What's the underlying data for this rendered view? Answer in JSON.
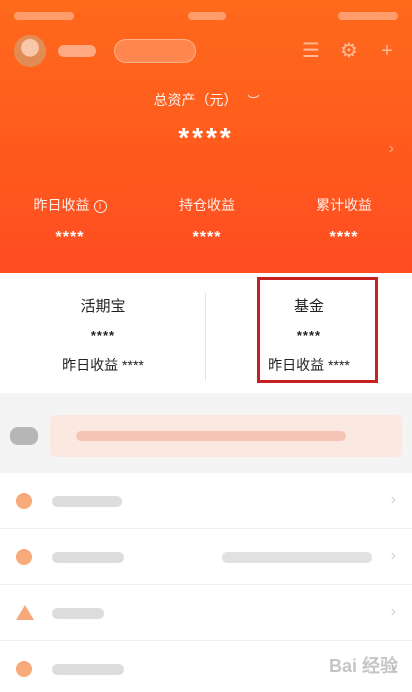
{
  "header": {
    "total_label": "总资产（元）",
    "total_value": "****",
    "eye_icon": "hidden-eye-icon",
    "earnings": [
      {
        "label": "昨日收益",
        "value": "****",
        "has_info": true
      },
      {
        "label": "持仓收益",
        "value": "****",
        "has_info": false
      },
      {
        "label": "累计收益",
        "value": "****",
        "has_info": false
      }
    ]
  },
  "cards": [
    {
      "title": "活期宝",
      "amount": "****",
      "sub_label": "昨日收益 ****"
    },
    {
      "title": "基金",
      "amount": "****",
      "sub_label": "昨日收益 ****"
    }
  ],
  "watermark": "Bai 经验",
  "colors": {
    "accent": "#ff5a1d",
    "highlight_box": "#c62020"
  }
}
